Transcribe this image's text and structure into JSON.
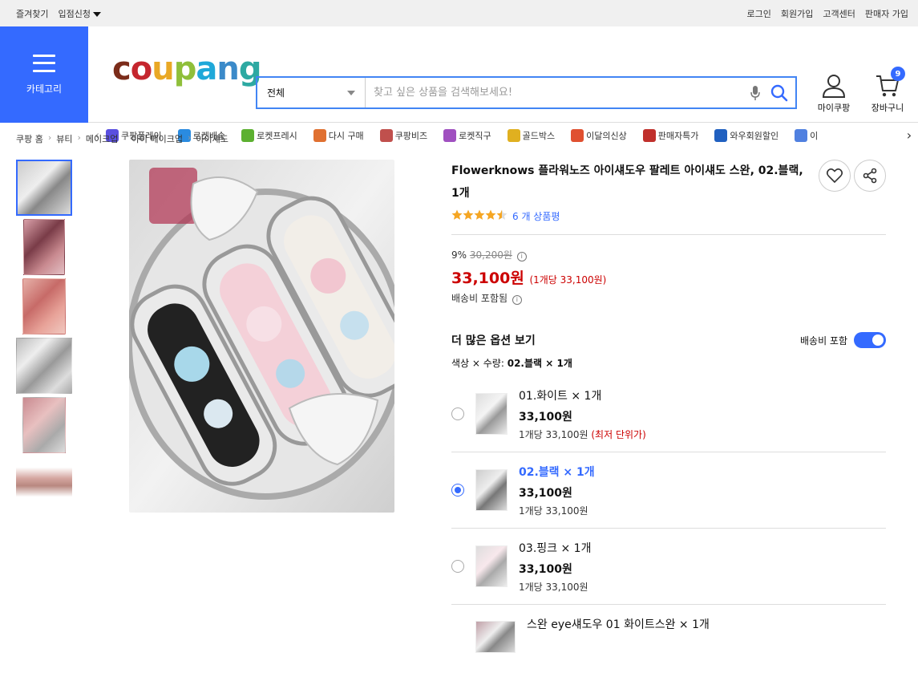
{
  "topbar": {
    "bookmark": "즐겨찾기",
    "apply": "입점신청",
    "login": "로그인",
    "signup": "회원가입",
    "cs": "고객센터",
    "seller": "판매자 가입"
  },
  "header": {
    "category_label": "카테고리",
    "search_select": "전체",
    "search_placeholder": "찾고 싶은 상품을 검색해보세요!",
    "mycoupang_label": "마이쿠팡",
    "cart_label": "장바구니",
    "cart_count": "9"
  },
  "logo_letters": [
    "c",
    "o",
    "u",
    "p",
    "a",
    "n",
    "g"
  ],
  "logo_colors": [
    "#7b2c1a",
    "#c5262e",
    "#e9a825",
    "#8fbf3a",
    "#1fa8d9",
    "#3b8ac9",
    "#2da9a2"
  ],
  "nav_items": [
    {
      "label": "쿠팡플레이",
      "icon": "play-icon"
    },
    {
      "label": "로켓배송",
      "icon": "rocket-icon"
    },
    {
      "label": "로켓프레시",
      "icon": "rocket-fresh-icon"
    },
    {
      "label": "다시 구매",
      "icon": "rebuy-icon"
    },
    {
      "label": "쿠팡비즈",
      "icon": "biz-icon"
    },
    {
      "label": "로켓직구",
      "icon": "rocket-global-icon"
    },
    {
      "label": "골드박스",
      "icon": "goldbox-icon"
    },
    {
      "label": "이달의신상",
      "icon": "new-icon"
    },
    {
      "label": "판매자특가",
      "icon": "percent-icon"
    },
    {
      "label": "와우회원할인",
      "icon": "wow-icon"
    },
    {
      "label": "이",
      "icon": "coupon-icon"
    }
  ],
  "breadcrumb": [
    "쿠팡 홈",
    "뷰티",
    "메이크업",
    "아이 메이크업",
    "아이섀도"
  ],
  "product": {
    "title": "Flowerknows 플라워노즈 아이섀도우 팔레트 아이섀도 스완, 02.블랙, 1개",
    "rating": 4.5,
    "review_text": "6 개 상품평",
    "discount_pct": "9%",
    "original_price": "30,200원",
    "price": "33,100원",
    "unit_price": "(1개당 33,100원)",
    "shipping": "배송비 포함됨"
  },
  "options": {
    "title": "더 많은 옵션 보기",
    "shipping_toggle_label": "배송비 포함",
    "shipping_toggle_on": true,
    "selected_label": "색상 × 수량:",
    "selected_value": "02.블랙 × 1개",
    "items": [
      {
        "name": "01.화이트 × 1개",
        "price": "33,100원",
        "unit": "1개당 33,100원",
        "note": "(최저 단위가)",
        "selected": false
      },
      {
        "name": "02.블랙 × 1개",
        "price": "33,100원",
        "unit": "1개당 33,100원",
        "note": "",
        "selected": true
      },
      {
        "name": "03.핑크 × 1개",
        "price": "33,100원",
        "unit": "1개당 33,100원",
        "note": "",
        "selected": false
      },
      {
        "name": "스완 eye섀도우 01 화이트스완 × 1개",
        "price": "",
        "unit": "",
        "note": "",
        "selected": false
      }
    ]
  },
  "colors": {
    "accent": "#346aff",
    "price_red": "#cc0000",
    "star": "#f5a623"
  }
}
